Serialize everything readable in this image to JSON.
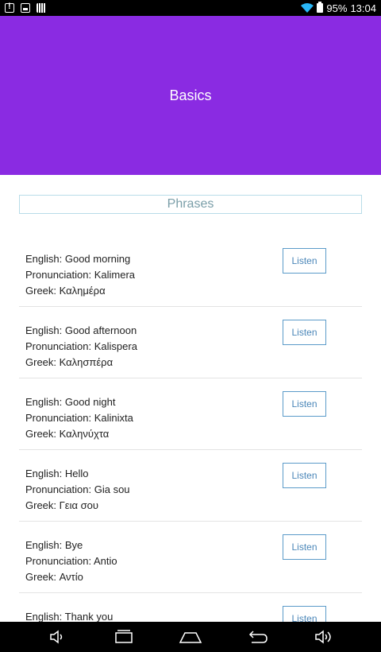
{
  "status": {
    "battery": "95%",
    "time": "13:04"
  },
  "header": {
    "title": "Basics",
    "color": "#8a2be2"
  },
  "section": {
    "title": "Phrases"
  },
  "phrases": [
    {
      "english": "English: Good morning",
      "pron": "Pronunciation: Kalimera",
      "greek": "Greek: Καλημέρα",
      "button": "Listen"
    },
    {
      "english": "English: Good afternoon",
      "pron": "Pronunciation: Kalispera",
      "greek": "Greek: Καλησπέρα",
      "button": "Listen"
    },
    {
      "english": "English: Good night",
      "pron": "Pronunciation: Kalinixta",
      "greek": "Greek: Καληνύχτα",
      "button": "Listen"
    },
    {
      "english": "English: Hello",
      "pron": "Pronunciation: Gia sou",
      "greek": "Greek: Γεια σου",
      "button": "Listen"
    },
    {
      "english": "English: Bye",
      "pron": "Pronunciation: Antio",
      "greek": "Greek: Αντίο",
      "button": "Listen"
    },
    {
      "english": "English: Thank you",
      "pron": "",
      "greek": "",
      "button": "Listen"
    }
  ],
  "nav": {
    "icons": [
      "volume-down-icon",
      "recent-apps-icon",
      "home-icon",
      "back-icon",
      "volume-up-icon"
    ]
  }
}
